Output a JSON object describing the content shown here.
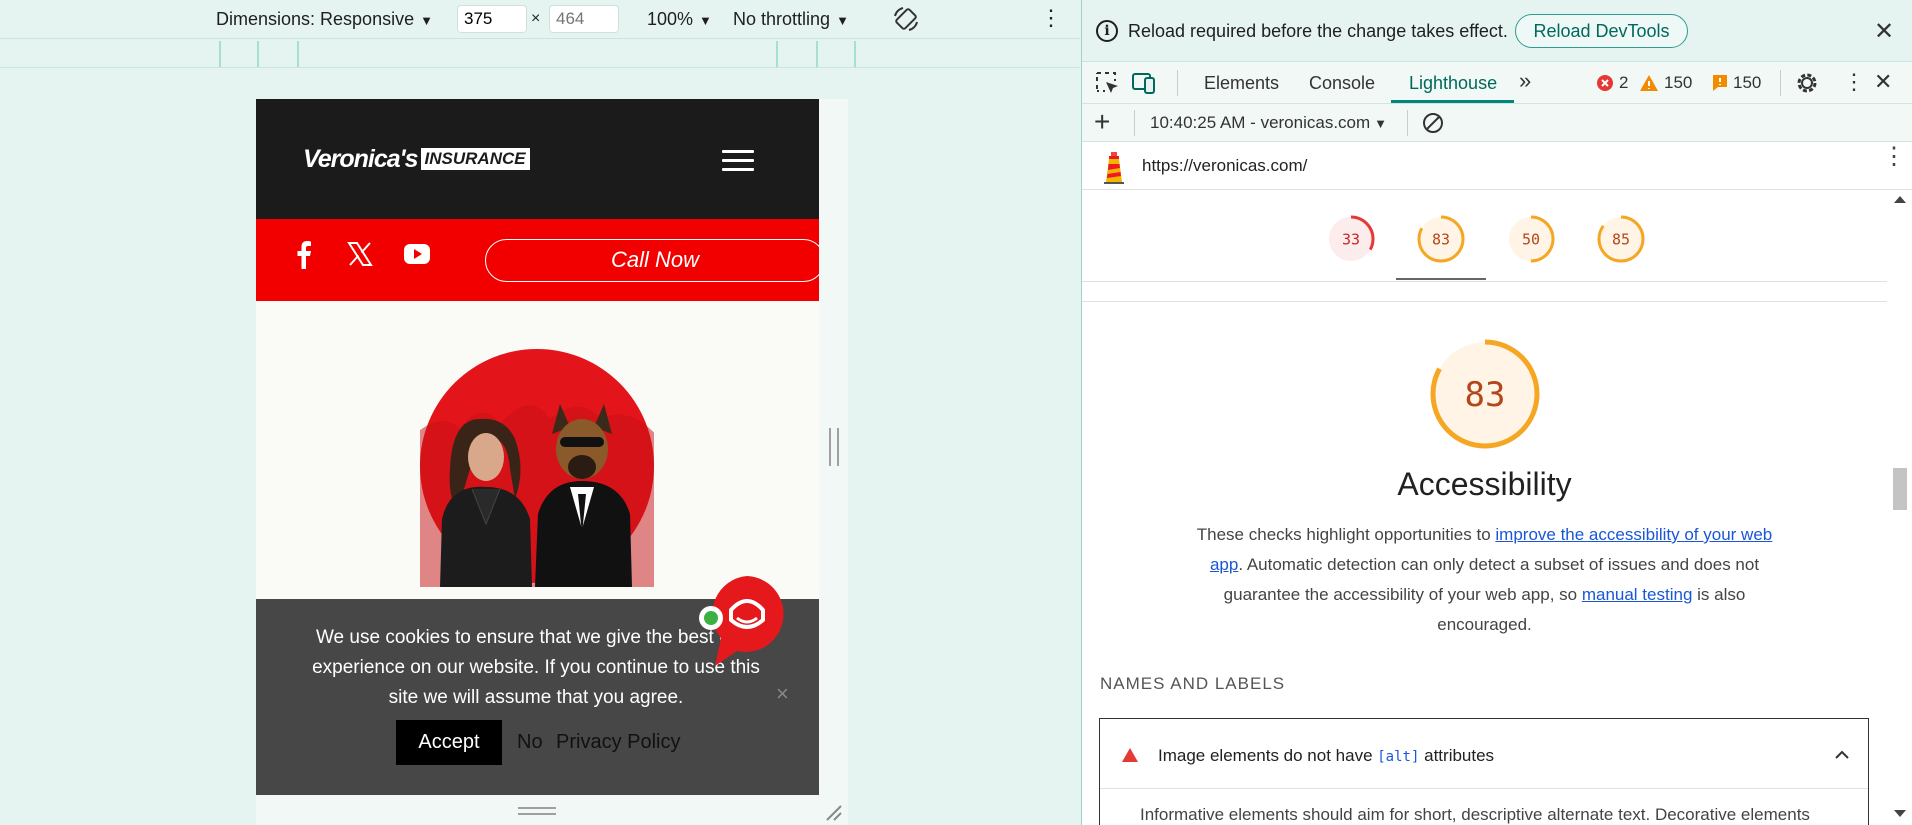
{
  "device_toolbar": {
    "dimensions_label": "Dimensions: Responsive",
    "width_value": "375",
    "height_placeholder": "464",
    "times": "×",
    "zoom": "100%",
    "throttling": "No throttling"
  },
  "site": {
    "logo_text": "Veronica's",
    "logo_box": "INSURANCE",
    "call_now": "Call Now",
    "social": [
      "facebook-icon",
      "x-icon",
      "youtube-icon"
    ],
    "cookie_text": "We use cookies to ensure that we give the best user experience on our website. If you continue to use this site we will assume that you agree.",
    "accept": "Accept",
    "no": "No",
    "privacy_policy": "Privacy Policy",
    "close": "×"
  },
  "devtools": {
    "info_text": "Reload required before the change takes effect.",
    "reload_button": "Reload DevTools",
    "tabs": [
      "Elements",
      "Console",
      "Lighthouse"
    ],
    "active_tab": "Lighthouse",
    "more_tabs": "»",
    "error_count": "2",
    "warning_count": "150",
    "issue_count": "150",
    "report_select": "10:40:25 AM - veronicas.com",
    "url": "https://veronicas.com/",
    "scores": [
      {
        "value": "33",
        "color": "#e53935",
        "fraction": 0.33
      },
      {
        "value": "83",
        "color": "#f5a623",
        "fraction": 0.83
      },
      {
        "value": "50",
        "color": "#f5a623",
        "fraction": 0.5
      },
      {
        "value": "85",
        "color": "#f5a623",
        "fraction": 0.85
      }
    ],
    "category": {
      "score": "83",
      "title": "Accessibility",
      "desc_1": "These checks highlight opportunities to ",
      "desc_link_1": "improve the accessibility of your web app",
      "desc_2": ". Automatic detection can only detect a subset of issues and does not guarantee the accessibility of your web app, so ",
      "desc_link_2": "manual testing",
      "desc_3": " is also encouraged."
    },
    "group_title": "NAMES AND LABELS",
    "audit": {
      "title_before": "Image elements do not have ",
      "title_code": "[alt]",
      "title_after": " attributes",
      "description": "Informative elements should aim for short, descriptive alternate text. Decorative elements"
    }
  },
  "colors": {
    "accent_teal": "#00897b",
    "brand_red": "#f20000",
    "score_average": "#f5a623",
    "score_fail": "#e53935",
    "link_blue": "#1a57d6"
  }
}
